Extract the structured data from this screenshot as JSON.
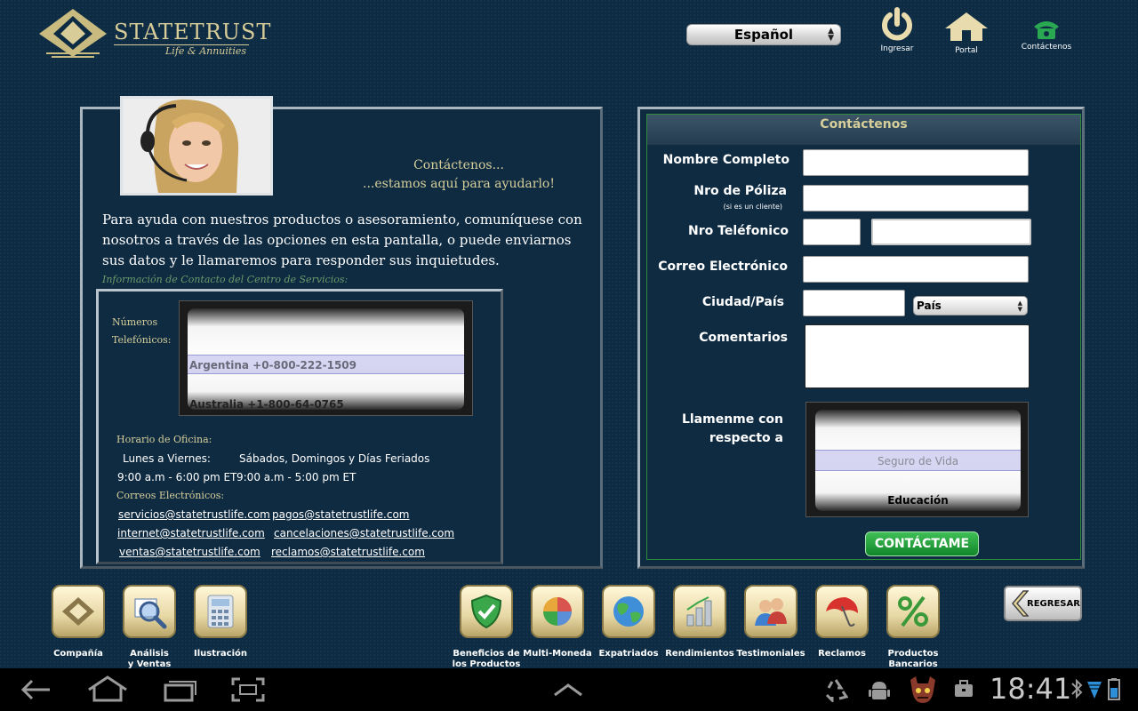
{
  "brand": {
    "name": "StateTrust",
    "tagline": "Life & Annuities"
  },
  "header": {
    "language_value": "Español",
    "icons": [
      {
        "name": "power-icon",
        "label": "Ingresar"
      },
      {
        "name": "home-icon",
        "label": "Portal"
      },
      {
        "name": "phone-icon",
        "label": "Contáctenos"
      }
    ]
  },
  "left": {
    "tagline_line1": "Contáctenos...",
    "tagline_line2": "...estamos aquí para ayudarlo!",
    "intro": "Para ayuda con nuestros productos o asesoramiento, comuníquese con nosotros a través de las opciones en esta pantalla, o puede enviarnos sus datos y le llamaremos para responder sus inquietudes.",
    "service_heading": "Información de Contacto del Centro de Servicios:",
    "phones_label_1": "Números",
    "phones_label_2": "Telefónicos:",
    "phones": [
      "Argentina +0-800-222-1509",
      "Australia +1-800-64-0765"
    ],
    "hours_label": "Horario de Oficina:",
    "weekday_label": "Lunes a Viernes:",
    "weekday_hours": "9:00 a.m - 6:00 pm ET",
    "weekend_label": "Sábados, Domingos y Días Feriados",
    "weekend_hours": "9:00 a.m - 5:00 pm ET",
    "emails_label": "Correos Electrónicos:",
    "emails": [
      "servicios@statetrustlife.com",
      "pagos@statetrustlife.com",
      "internet@statetrustlife.com",
      "cancelaciones@statetrustlife.com",
      "ventas@statetrustlife.com",
      "reclamos@statetrustlife.com"
    ]
  },
  "form": {
    "title": "Contáctenos",
    "full_name_label": "Nombre Completo",
    "policy_label": "Nro de Póliza",
    "policy_note": "(si es un cliente)",
    "phone_label": "Nro Teléfonico",
    "email_label": "Correo Electrónico",
    "city_label": "Ciudad/País",
    "country_value": "País",
    "comments_label": "Comentarios",
    "callme_label_1": "Llamenme con",
    "callme_label_2": "respecto a",
    "topics": [
      "Seguro de Vida",
      "Educación"
    ],
    "submit": "CONTÁCTAME"
  },
  "bottom_nav": {
    "left": [
      {
        "label_1": "Compañía",
        "label_2": ""
      },
      {
        "label_1": "Análisis",
        "label_2": "y Ventas"
      },
      {
        "label_1": "Ilustración",
        "label_2": ""
      }
    ],
    "right": [
      {
        "label_1": "Beneficios de",
        "label_2": "los Productos"
      },
      {
        "label_1": "Multi-Moneda",
        "label_2": ""
      },
      {
        "label_1": "Expatriados",
        "label_2": ""
      },
      {
        "label_1": "Rendimientos",
        "label_2": ""
      },
      {
        "label_1": "Testimoniales",
        "label_2": ""
      },
      {
        "label_1": "Reclamos",
        "label_2": ""
      },
      {
        "label_1": "Productos",
        "label_2": "Bancarios"
      }
    ],
    "back": "REGRESAR"
  },
  "system_bar": {
    "time": "18:41"
  }
}
